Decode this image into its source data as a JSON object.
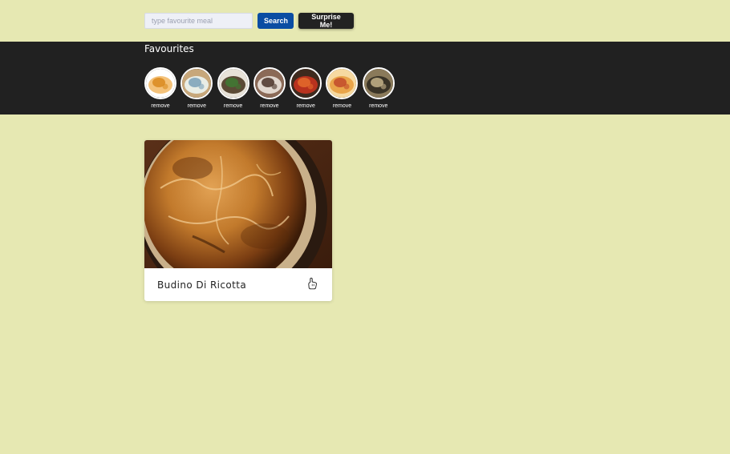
{
  "search": {
    "placeholder": "type favourite meal",
    "value": "",
    "search_label": "Search",
    "surprise_label": "Surprise Me!"
  },
  "favourites": {
    "title": "Favourites",
    "items": [
      {
        "remove_label": "remove",
        "thumb_colors": [
          "#f4c27a",
          "#d98a1e",
          "#ffffff"
        ]
      },
      {
        "remove_label": "remove",
        "thumb_colors": [
          "#e9ede5",
          "#7aa0b8",
          "#c7a77a"
        ]
      },
      {
        "remove_label": "remove",
        "thumb_colors": [
          "#5b4a36",
          "#3f7a32",
          "#e7e2d8"
        ]
      },
      {
        "remove_label": "remove",
        "thumb_colors": [
          "#e2d8cf",
          "#4a3328",
          "#8b6a57"
        ]
      },
      {
        "remove_label": "remove",
        "thumb_colors": [
          "#b8321e",
          "#e46b2c",
          "#3e2a1e"
        ]
      },
      {
        "remove_label": "remove",
        "thumb_colors": [
          "#e9a54a",
          "#c24a2a",
          "#f6d9a0"
        ]
      },
      {
        "remove_label": "remove",
        "thumb_colors": [
          "#3a3427",
          "#c6b48a",
          "#8a7a5a"
        ]
      }
    ]
  },
  "meal": {
    "name": "Budino Di Ricotta",
    "like_icon": "thumbs-up-icon"
  },
  "colors": {
    "background": "#e6e8b2",
    "fav_bar": "#212121",
    "search_button": "#0a4da3",
    "surprise_button": "#222222"
  }
}
